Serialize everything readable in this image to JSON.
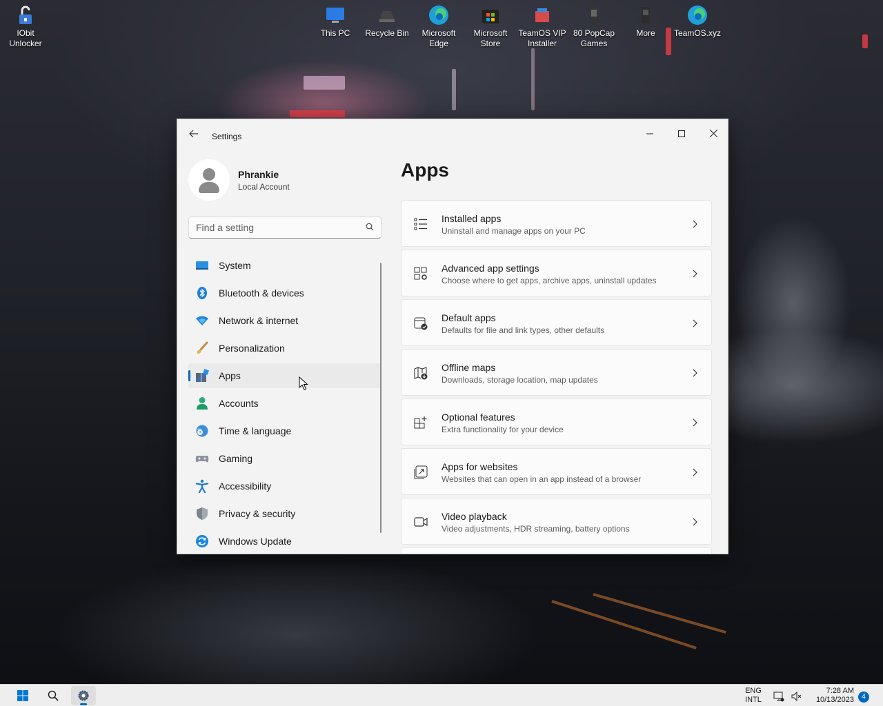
{
  "desktop": {
    "icons": [
      {
        "label": "IObit Unlocker"
      },
      {
        "label": "This PC"
      },
      {
        "label": "Recycle Bin"
      },
      {
        "label": "Microsoft Edge"
      },
      {
        "label": "Microsoft Store"
      },
      {
        "label": "TeamOS VIP Installer"
      },
      {
        "label": "80 PopCap Games"
      },
      {
        "label": "More"
      },
      {
        "label": "TeamOS.xyz"
      }
    ]
  },
  "window": {
    "title": "Settings",
    "back_icon": "back-arrow-icon",
    "minimize_icon": "minimize-icon",
    "maximize_icon": "maximize-icon",
    "close_icon": "close-icon"
  },
  "profile": {
    "name": "Phrankie",
    "account_type": "Local Account"
  },
  "search": {
    "placeholder": "Find a setting",
    "icon": "search-icon"
  },
  "nav": {
    "items": [
      {
        "label": "System",
        "icon": "system-icon"
      },
      {
        "label": "Bluetooth & devices",
        "icon": "bluetooth-icon"
      },
      {
        "label": "Network & internet",
        "icon": "wifi-icon"
      },
      {
        "label": "Personalization",
        "icon": "brush-icon"
      },
      {
        "label": "Apps",
        "icon": "apps-icon",
        "selected": true
      },
      {
        "label": "Accounts",
        "icon": "person-icon"
      },
      {
        "label": "Time & language",
        "icon": "globe-clock-icon"
      },
      {
        "label": "Gaming",
        "icon": "gamepad-icon"
      },
      {
        "label": "Accessibility",
        "icon": "accessibility-icon"
      },
      {
        "label": "Privacy & security",
        "icon": "shield-icon"
      },
      {
        "label": "Windows Update",
        "icon": "update-icon"
      }
    ]
  },
  "main": {
    "title": "Apps",
    "cards": [
      {
        "title": "Installed apps",
        "desc": "Uninstall and manage apps on your PC",
        "icon": "list-icon"
      },
      {
        "title": "Advanced app settings",
        "desc": "Choose where to get apps, archive apps, uninstall updates",
        "icon": "app-settings-icon"
      },
      {
        "title": "Default apps",
        "desc": "Defaults for file and link types, other defaults",
        "icon": "default-apps-icon"
      },
      {
        "title": "Offline maps",
        "desc": "Downloads, storage location, map updates",
        "icon": "map-download-icon"
      },
      {
        "title": "Optional features",
        "desc": "Extra functionality for your device",
        "icon": "add-feature-icon"
      },
      {
        "title": "Apps for websites",
        "desc": "Websites that can open in an app instead of a browser",
        "icon": "open-external-icon"
      },
      {
        "title": "Video playback",
        "desc": "Video adjustments, HDR streaming, battery options",
        "icon": "video-camera-icon"
      }
    ]
  },
  "taskbar": {
    "lang_top": "ENG",
    "lang_bottom": "INTL",
    "time": "7:28 AM",
    "date": "10/13/2023",
    "notification_count": "4"
  },
  "colors": {
    "accent": "#0067c0",
    "window_bg": "#f3f3f3",
    "card_bg": "#fbfbfb",
    "taskbar_bg": "#eeeeee"
  }
}
